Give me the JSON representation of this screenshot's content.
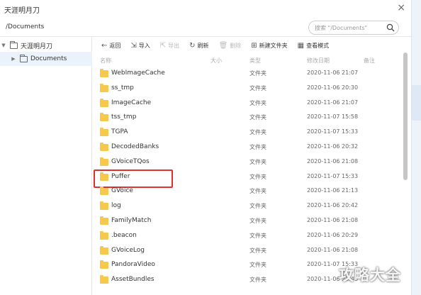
{
  "window": {
    "title": "天涯明月刀",
    "close_glyph": "×"
  },
  "address": {
    "path": "/Documents",
    "search_placeholder": "搜索 \"/Documents\""
  },
  "sidebar": {
    "root": {
      "arrow": "▼",
      "label": "天涯明月刀"
    },
    "child": {
      "arrow": "▶",
      "label": "Documents"
    }
  },
  "toolbar": {
    "back": "返回",
    "import": "导入",
    "export": "导出",
    "refresh": "刷新",
    "delete": "删除",
    "new_folder": "新建文件夹",
    "view_mode": "查看模式"
  },
  "columns": {
    "name": "名称",
    "size": "大小",
    "type": "类型",
    "modified": "修改日期",
    "note": "备注"
  },
  "files": [
    {
      "name": "WebImageCache",
      "type": "文件夹",
      "date": "2020-11-06 21:07"
    },
    {
      "name": "ss_tmp",
      "type": "文件夹",
      "date": "2020-11-06 20:30"
    },
    {
      "name": "ImageCache",
      "type": "文件夹",
      "date": "2020-11-06 21:07"
    },
    {
      "name": "tss_tmp",
      "type": "文件夹",
      "date": "2020-11-07 15:58"
    },
    {
      "name": "TGPA",
      "type": "文件夹",
      "date": "2020-11-07 15:33"
    },
    {
      "name": "DecodedBanks",
      "type": "文件夹",
      "date": "2020-11-06 20:32"
    },
    {
      "name": "GVoiceTQos",
      "type": "文件夹",
      "date": "2020-11-06 21:08"
    },
    {
      "name": "Puffer",
      "type": "文件夹",
      "date": "2020-11-07 15:33"
    },
    {
      "name": "GVoice",
      "type": "文件夹",
      "date": "2020-11-06 21:13"
    },
    {
      "name": "log",
      "type": "文件夹",
      "date": "2020-11-06 20:42"
    },
    {
      "name": "FamilyMatch",
      "type": "文件夹",
      "date": "2020-11-06 21:08"
    },
    {
      "name": ".beacon",
      "type": "文件夹",
      "date": "2020-11-06 20:29"
    },
    {
      "name": "GVoiceLog",
      "type": "文件夹",
      "date": "2020-11-06 21:08"
    },
    {
      "name": "PandoraVideo",
      "type": "文件夹",
      "date": "2020-11-07 15:33"
    },
    {
      "name": "AssetBundles",
      "type": "文件夹",
      "date": "2020-11-06 21:43"
    }
  ],
  "watermark": "攻略大全"
}
